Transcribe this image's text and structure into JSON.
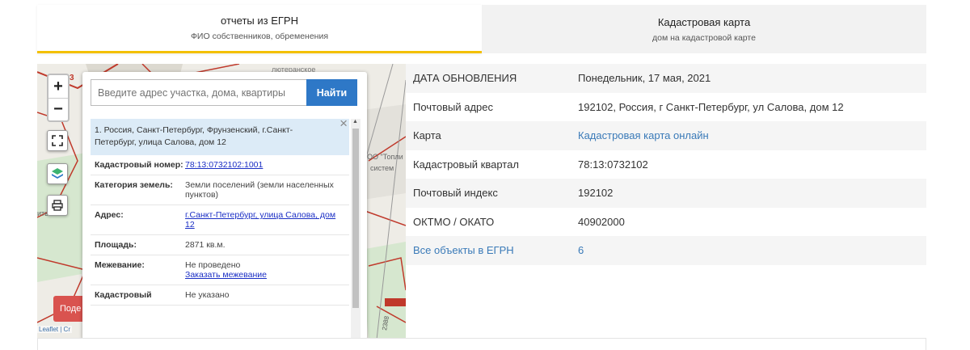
{
  "tabs": [
    {
      "title": "отчеты из ЕГРН",
      "subtitle": "ФИО собственников, обременения"
    },
    {
      "title": "Кадастровая карта",
      "subtitle": "дом на кадастровой карте"
    }
  ],
  "map": {
    "zoom_in": "+",
    "zoom_out": "−",
    "search_placeholder": "Введите адрес участка, дома, квартиры",
    "search_button": "Найти",
    "red_button": "Поде",
    "attribution": "Leaflet | Cr",
    "labels": {
      "lutheran": "лютеранское",
      "number_48": "48",
      "number_3": "3",
      "ooo": "ОО \"Топли",
      "systems": "систем",
      "street_no": "2388",
      "left_text": "ить"
    },
    "result": {
      "title": "1. Россия, Санкт-Петербург, Фрунзенский, г.Санкт-Петербург, улица Салова, дом 12",
      "close": "×",
      "rows": [
        {
          "key": "Кадастровый номер:",
          "value": "78:13:0732102:1001",
          "link": true
        },
        {
          "key": "Категория земель:",
          "value": "Земли поселений (земли населенных пунктов)",
          "link": false
        },
        {
          "key": "Адрес:",
          "value": "г.Санкт-Петербург, улица Салова, дом 12",
          "link": true
        },
        {
          "key": "Площадь:",
          "value": "2871 кв.м.",
          "link": false
        },
        {
          "key": "Межевание:",
          "value": "Не проведено",
          "link": false,
          "extra_link": "Заказать межевание"
        },
        {
          "key": "Кадастровый",
          "value": "Не указано",
          "link": false
        }
      ]
    }
  },
  "info_rows": [
    {
      "label": "ДАТА ОБНОВЛЕНИЯ",
      "value": "Понедельник, 17 мая, 2021",
      "label_link": false,
      "value_link": false
    },
    {
      "label": "Почтовый адрес",
      "value": "192102, Россия, г Санкт-Петербург, ул Салова, дом 12",
      "label_link": false,
      "value_link": false
    },
    {
      "label": "Карта",
      "value": "Кадастровая карта онлайн",
      "label_link": false,
      "value_link": true
    },
    {
      "label": "Кадастровый квартал",
      "value": "78:13:0732102",
      "label_link": false,
      "value_link": false
    },
    {
      "label": "Почтовый индекс",
      "value": "192102",
      "label_link": false,
      "value_link": false
    },
    {
      "label": "ОКТМО / ОКАТО",
      "value": "40902000",
      "label_link": false,
      "value_link": false
    },
    {
      "label": "Все объекты в ЕГРН",
      "value": "6",
      "label_link": true,
      "value_link": true
    }
  ],
  "colors": {
    "accent_yellow": "#f3c000",
    "search_blue": "#2e78c7",
    "link_blue": "#3a7ab8",
    "red": "#d9534f"
  }
}
